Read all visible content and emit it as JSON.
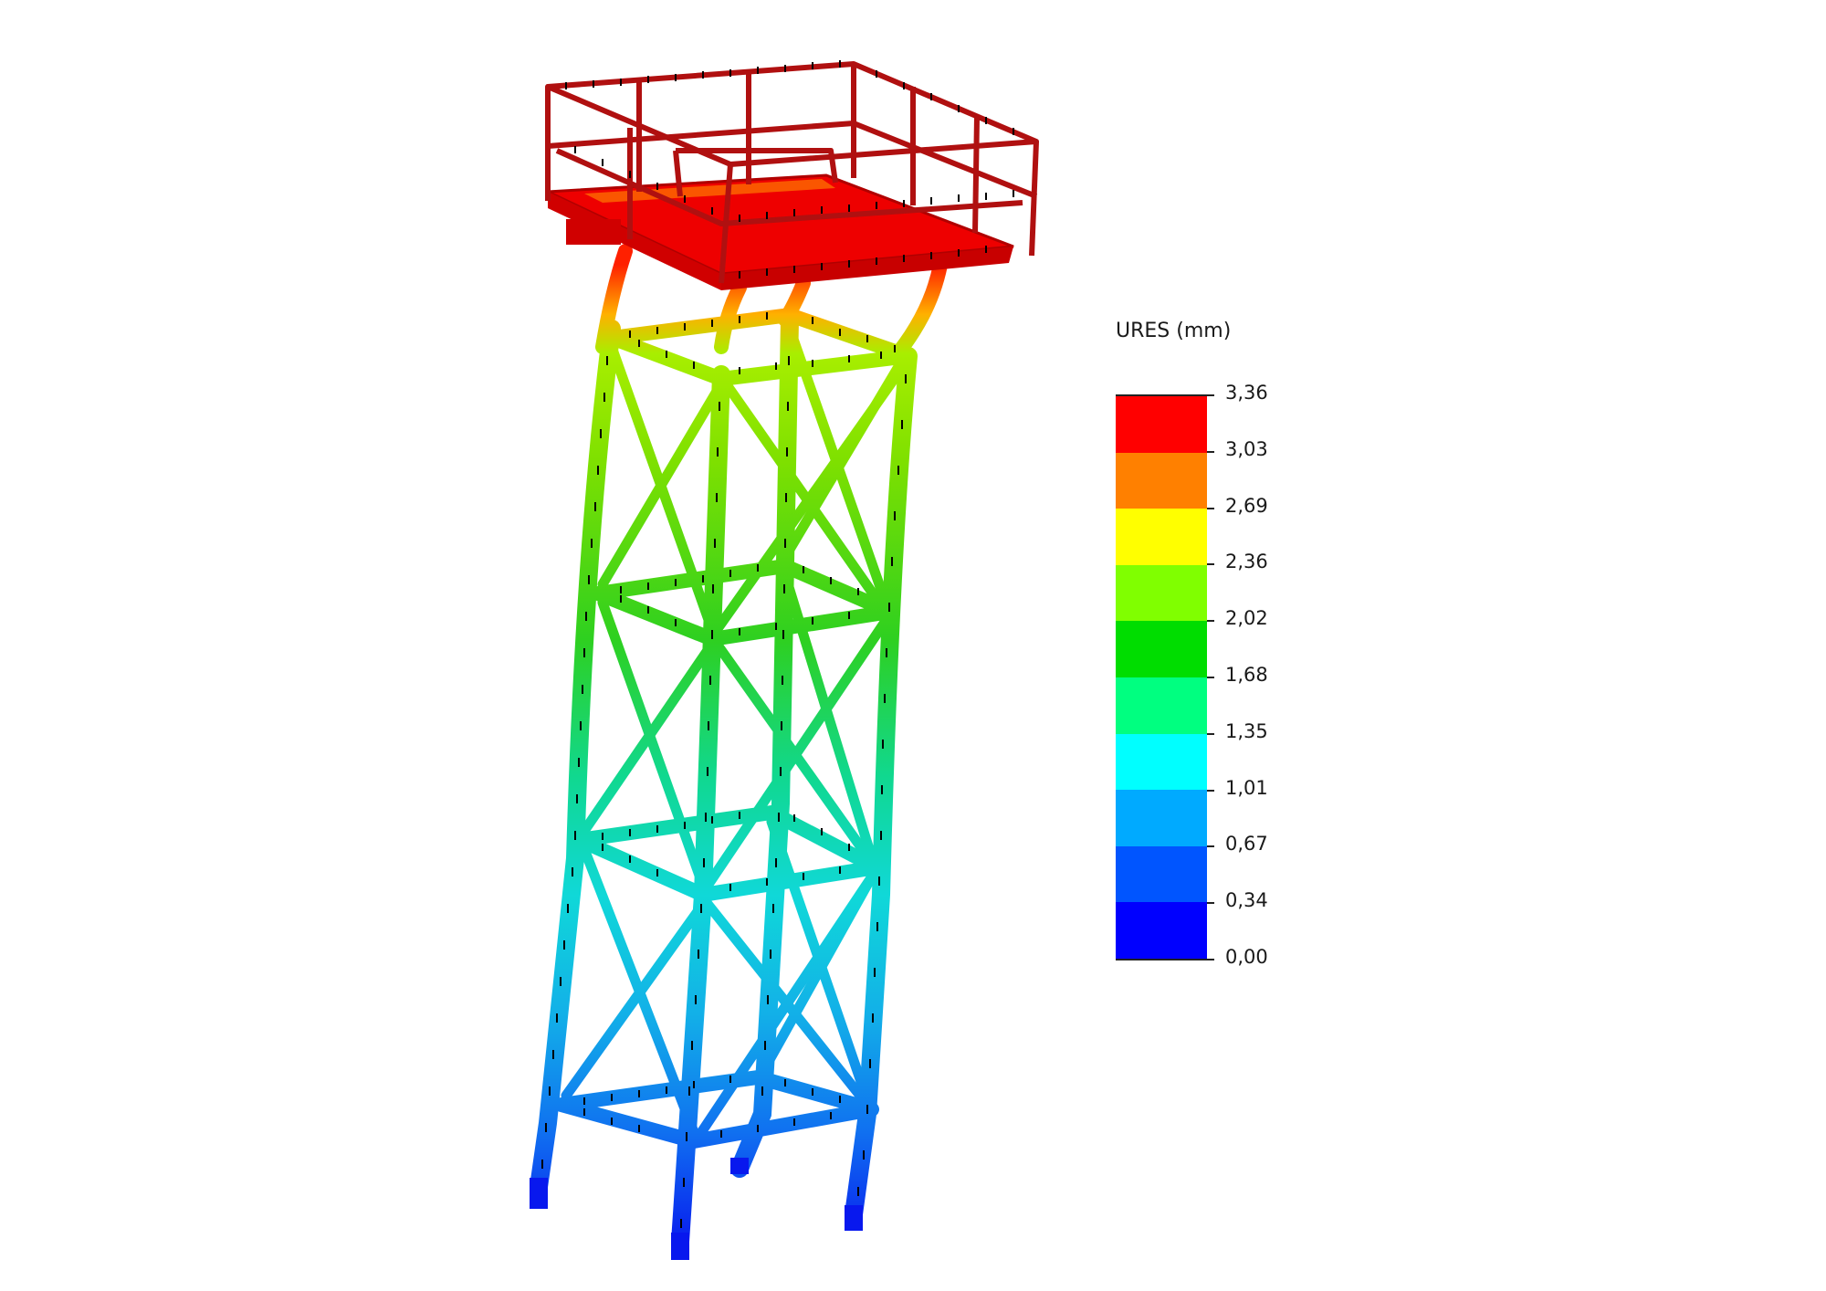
{
  "viewport": {
    "background": "#ffffff"
  },
  "model": {
    "platform_color": "#ee0000",
    "railing_color": "#b01010",
    "node_mark_color": "#000000",
    "displacement_gradient": [
      "#ff0000",
      "#ff8000",
      "#ffff00",
      "#80ff00",
      "#00dd00",
      "#00ff80",
      "#00ffff",
      "#00aaff",
      "#0055ff",
      "#0000ff"
    ]
  },
  "legend": {
    "title": "URES (mm)",
    "labels": [
      "3,36",
      "3,03",
      "2,69",
      "2,36",
      "2,02",
      "1,68",
      "1,35",
      "1,01",
      "0,67",
      "0,34",
      "0,00"
    ],
    "bands": [
      {
        "color": "#ff0000"
      },
      {
        "color": "#ff8000"
      },
      {
        "color": "#ffff00"
      },
      {
        "color": "#80ff00"
      },
      {
        "color": "#00dd00"
      },
      {
        "color": "#00ff80"
      },
      {
        "color": "#00ffff"
      },
      {
        "color": "#00aaff"
      },
      {
        "color": "#0055ff"
      },
      {
        "color": "#0000ff"
      }
    ]
  }
}
